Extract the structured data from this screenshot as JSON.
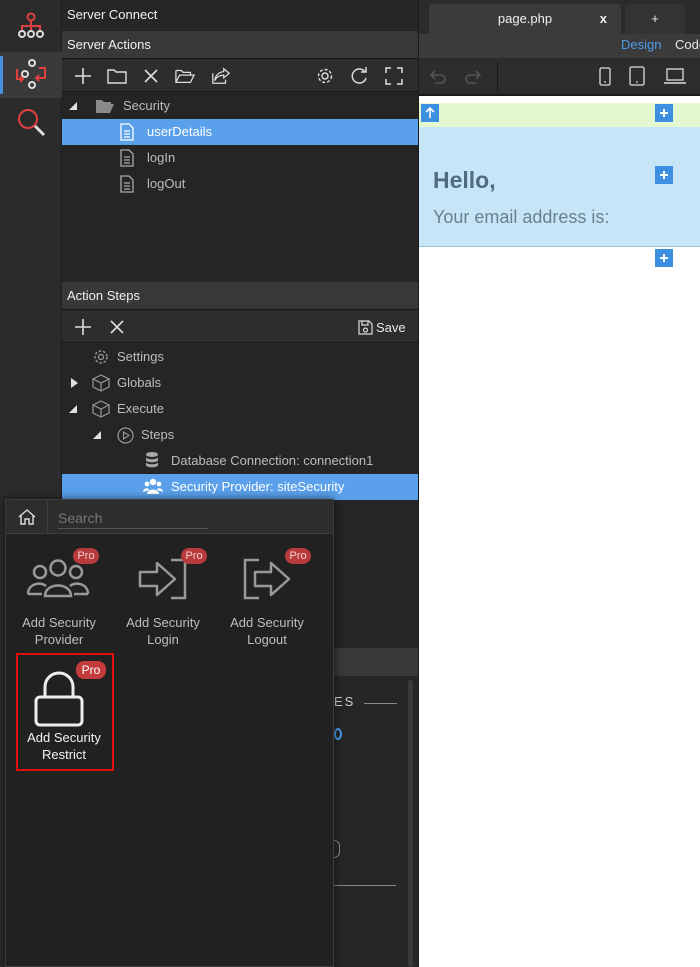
{
  "colors": {
    "accent": "#4a90e2",
    "selection": "#5aa0ea",
    "pro": "#b83a3a",
    "highlight_border": "#e01010",
    "link": "#4a9be8"
  },
  "rail": {
    "items": [
      {
        "icon": "sitemap-icon"
      },
      {
        "icon": "server-connect-icon"
      },
      {
        "icon": "search-icon"
      }
    ]
  },
  "server_connect": {
    "title": "Server Connect"
  },
  "server_actions": {
    "title": "Server Actions",
    "toolbar_icons": [
      "add-icon",
      "new-folder-icon",
      "delete-icon",
      "open-folder-icon",
      "export-icon",
      "settings-gear-icon",
      "refresh-icon",
      "fullscreen-icon"
    ],
    "tree": [
      {
        "label": "Security",
        "type": "folder",
        "expanded": true
      },
      {
        "label": "userDetails",
        "type": "file",
        "selected": true
      },
      {
        "label": "logIn",
        "type": "file"
      },
      {
        "label": "logOut",
        "type": "file"
      }
    ]
  },
  "action_steps": {
    "title": "Action Steps",
    "save_label": "Save",
    "items": [
      {
        "label": "Settings"
      },
      {
        "label": "Globals"
      },
      {
        "label": "Execute"
      },
      {
        "label": "Steps"
      },
      {
        "label": "Database Connection: connection1"
      },
      {
        "label": "Security Provider: siteSecurity",
        "selected": true
      }
    ]
  },
  "tabs": {
    "active": "page.php",
    "close": "x",
    "new": "+"
  },
  "modes": {
    "design": "Design",
    "code": "Code"
  },
  "canvas": {
    "hello": "Hello,",
    "email_text": "Your email address is:"
  },
  "flyout": {
    "search_placeholder": "Search",
    "items": [
      {
        "line1": "Add Security",
        "line2": "Provider",
        "pro": "Pro"
      },
      {
        "line1": "Add Security",
        "line2": "Login",
        "pro": "Pro"
      },
      {
        "line1": "Add Security",
        "line2": "Logout",
        "pro": "Pro"
      },
      {
        "line1": "Add Security",
        "line2": "Restrict",
        "pro": "Pro",
        "highlighted": true
      }
    ]
  },
  "under_panel": {
    "partial_label": "ES"
  }
}
